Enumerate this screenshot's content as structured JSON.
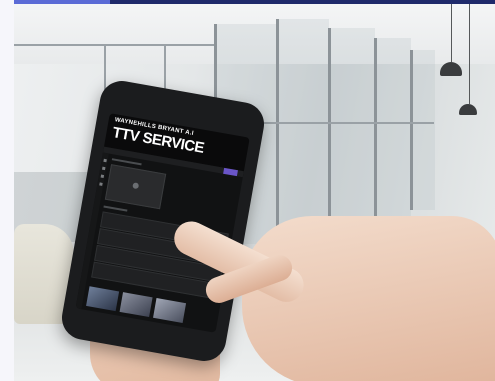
{
  "phone_screen": {
    "subtitle": "WAYNEHILLS BRYANT A.I",
    "title": "TTV SERVICE"
  }
}
